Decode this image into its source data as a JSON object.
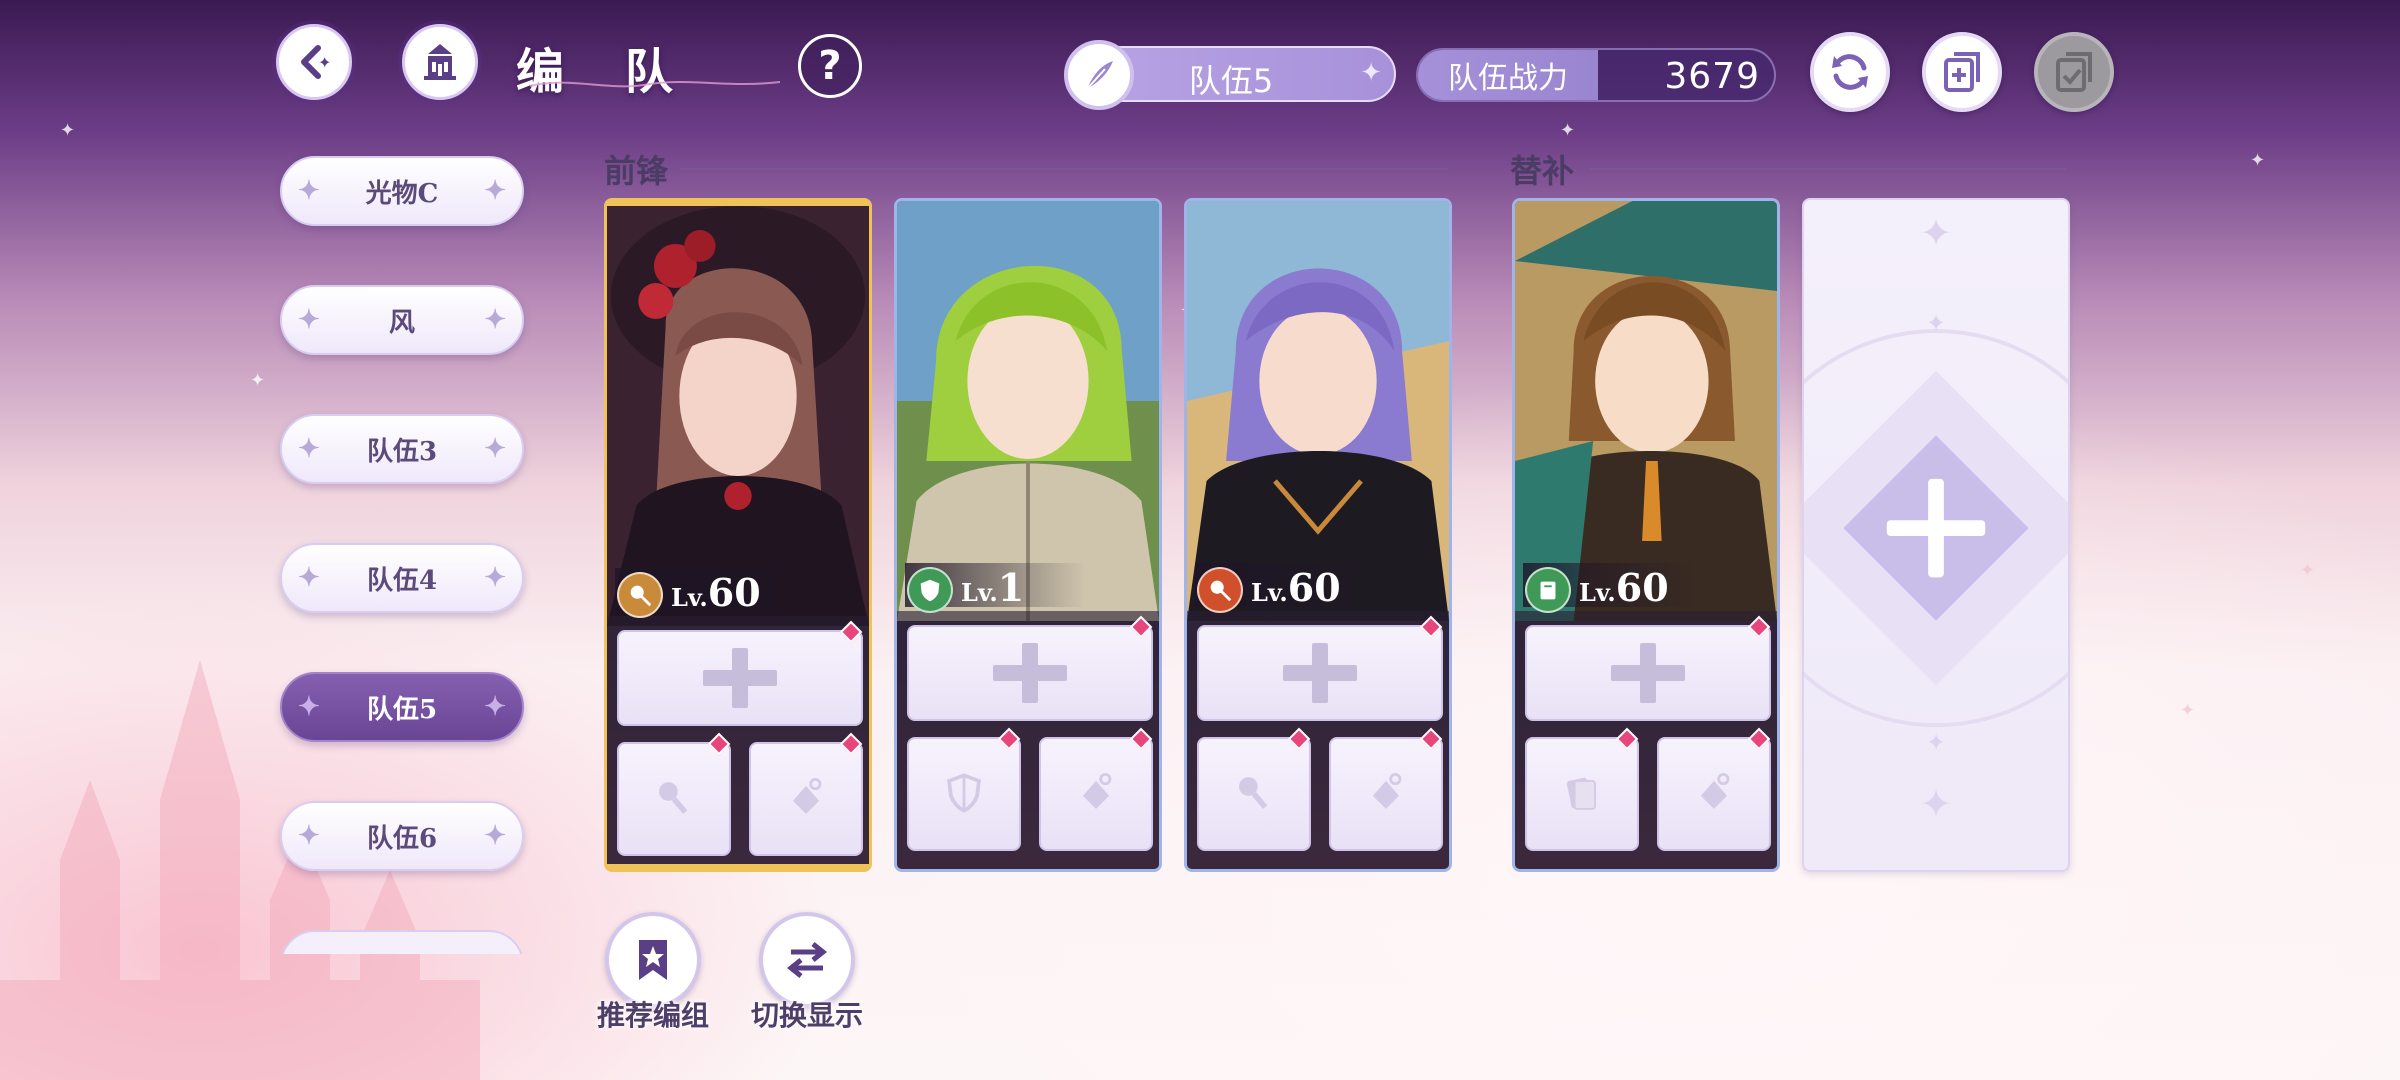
{
  "header": {
    "title": "编 队",
    "help_label": "?",
    "current_team": "队伍5",
    "power_label": "队伍战力",
    "power_value": "3679"
  },
  "sidebar": {
    "items": [
      {
        "label": "光物C",
        "active": false
      },
      {
        "label": "风",
        "active": false
      },
      {
        "label": "队伍3",
        "active": false
      },
      {
        "label": "队伍4",
        "active": false
      },
      {
        "label": "队伍5",
        "active": true
      },
      {
        "label": "队伍6",
        "active": false
      }
    ]
  },
  "sections": {
    "vanguard": "前锋",
    "substitute": "替补"
  },
  "characters": [
    {
      "level_prefix": "Lv.",
      "level": "60",
      "class_icon": "mace-icon",
      "class_color": "#c98a3a",
      "highlight": "gold"
    },
    {
      "level_prefix": "Lv.",
      "level": "1",
      "class_icon": "shield-icon",
      "class_color": "#3f9a58",
      "highlight": "blue"
    },
    {
      "level_prefix": "Lv.",
      "level": "60",
      "class_icon": "mace-icon",
      "class_color": "#d0502c",
      "highlight": "blue"
    },
    {
      "level_prefix": "Lv.",
      "level": "60",
      "class_icon": "book-icon",
      "class_color": "#3f9a58",
      "highlight": "blue"
    }
  ],
  "bottom": {
    "recommend_label": "推荐编组",
    "switch_label": "切换显示"
  },
  "colors": {
    "accent_purple": "#6a4596",
    "gem_pink": "#e8457c",
    "card_border_gold": "#f0c35a",
    "card_border_blue": "#9fb5ea"
  }
}
